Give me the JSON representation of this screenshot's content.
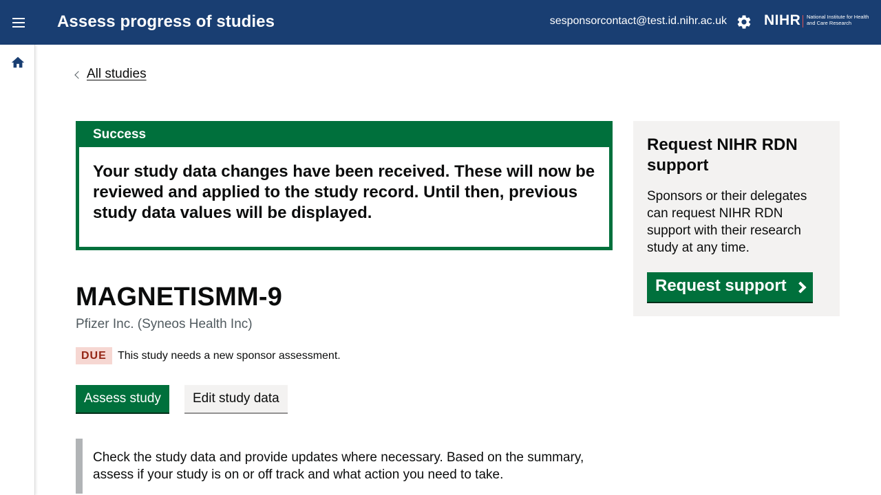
{
  "header": {
    "title": "Assess progress of studies",
    "user_email": "sesponsorcontact@test.id.nihr.ac.uk",
    "logo_text": "NIHR",
    "logo_subtext": "National Institute for Health and Care Research",
    "menu_icon": "menu-icon",
    "settings_icon": "gear-icon"
  },
  "sidebar": {
    "home_icon": "home-icon"
  },
  "breadcrumb": {
    "back_label": "All studies"
  },
  "notification": {
    "heading": "Success",
    "message": "Your study data changes have been received. These will now be reviewed and applied to the study record. Until then, previous study data values will be displayed."
  },
  "study": {
    "title": "MAGNETISMM-9",
    "sponsor": "Pfizer Inc. (Syneos Health Inc)",
    "status_tag": "DUE",
    "status_message": "This study needs a new sponsor assessment.",
    "assess_button": "Assess study",
    "edit_button": "Edit study data",
    "inset_text": "Check the study data and provide updates where necessary. Based on the summary, assess if your study is on or off track and what action you need to take."
  },
  "support_panel": {
    "title": "Request NIHR RDN support",
    "text": "Sponsors or their delegates can request NIHR RDN support with their research study at any time.",
    "button": "Request support"
  },
  "colors": {
    "header_bg": "#193e72",
    "success_green": "#00703c",
    "due_tag_bg": "#f6d7d2",
    "due_tag_text": "#942514",
    "panel_bg": "#f3f2f1"
  }
}
